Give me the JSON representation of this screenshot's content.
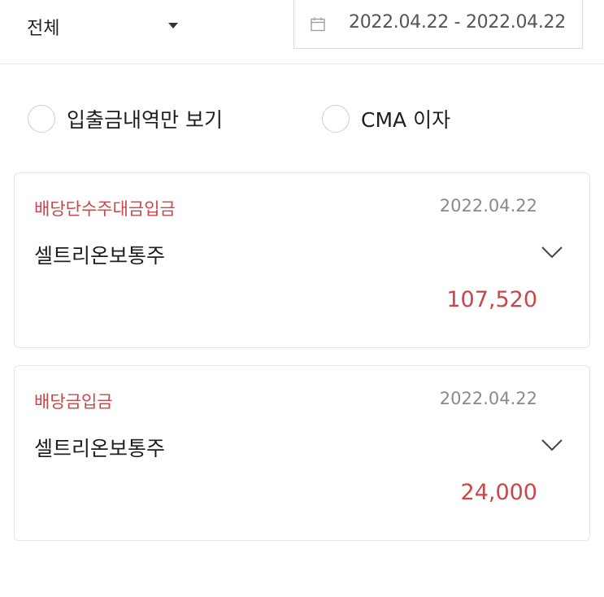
{
  "filter": {
    "category_label": "전체",
    "category_icon": "caret-down-icon",
    "date_icon": "calendar-icon",
    "date_range": "2022.04.22 - 2022.04.22"
  },
  "options": [
    {
      "label": "입출금내역만 보기",
      "checked": false
    },
    {
      "label": "CMA 이자",
      "checked": false
    }
  ],
  "transactions": [
    {
      "type": "배당단수주대금입금",
      "date": "2022.04.22",
      "name": "셀트리온보통주",
      "amount": "107,520"
    },
    {
      "type": "배당금입금",
      "date": "2022.04.22",
      "name": "셀트리온보통주",
      "amount": "24,000"
    }
  ],
  "colors": {
    "accent_red": "#c9474b",
    "muted_gray": "#8a8a8a",
    "border": "#e6e6e6"
  }
}
